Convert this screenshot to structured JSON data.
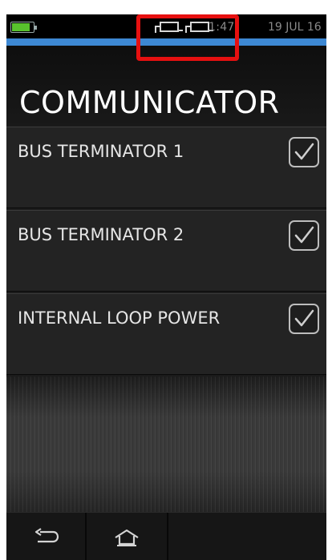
{
  "status_bar": {
    "time": "1:47",
    "date": "19 JUL 16",
    "battery_level": 0.85,
    "icons": [
      "battery-icon",
      "usb-icon",
      "usb-icon"
    ]
  },
  "colors": {
    "accent": "#3d88d3",
    "highlight": "#e61010",
    "battery": "#58c22d"
  },
  "header": {
    "title": "COMMUNICATOR"
  },
  "settings": [
    {
      "label": "BUS TERMINATOR 1",
      "checked": true
    },
    {
      "label": "BUS TERMINATOR 2",
      "checked": true
    },
    {
      "label": "INTERNAL LOOP POWER",
      "checked": true
    }
  ],
  "nav": {
    "icons": [
      "back-icon",
      "home-icon"
    ]
  }
}
